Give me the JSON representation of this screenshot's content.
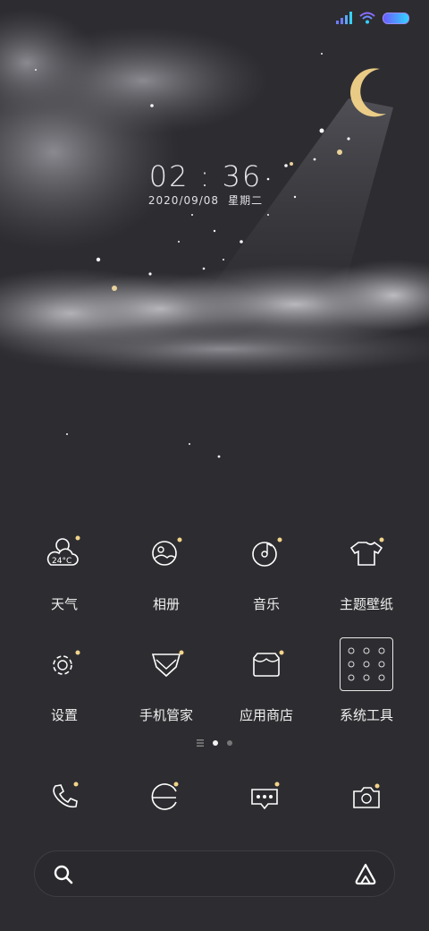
{
  "clock": {
    "time": "02 : 36",
    "date": "2020/09/08",
    "weekday": "星期二"
  },
  "apps": [
    {
      "label": "天气",
      "icon": "weather-icon",
      "temp": "24°C"
    },
    {
      "label": "相册",
      "icon": "gallery-icon"
    },
    {
      "label": "音乐",
      "icon": "music-icon"
    },
    {
      "label": "主题壁纸",
      "icon": "themes-icon"
    },
    {
      "label": "设置",
      "icon": "settings-icon"
    },
    {
      "label": "手机管家",
      "icon": "security-icon"
    },
    {
      "label": "应用商店",
      "icon": "app-store-icon"
    },
    {
      "label": "系统工具",
      "icon": "tools-folder-icon"
    }
  ],
  "pager": {
    "pages": 2,
    "current": 1
  },
  "dock": [
    "phone-icon",
    "browser-icon",
    "messages-icon",
    "camera-icon"
  ],
  "colors": {
    "background": "#2d2d31",
    "accent": "#f3d48a",
    "battery": "#6c5cff"
  }
}
